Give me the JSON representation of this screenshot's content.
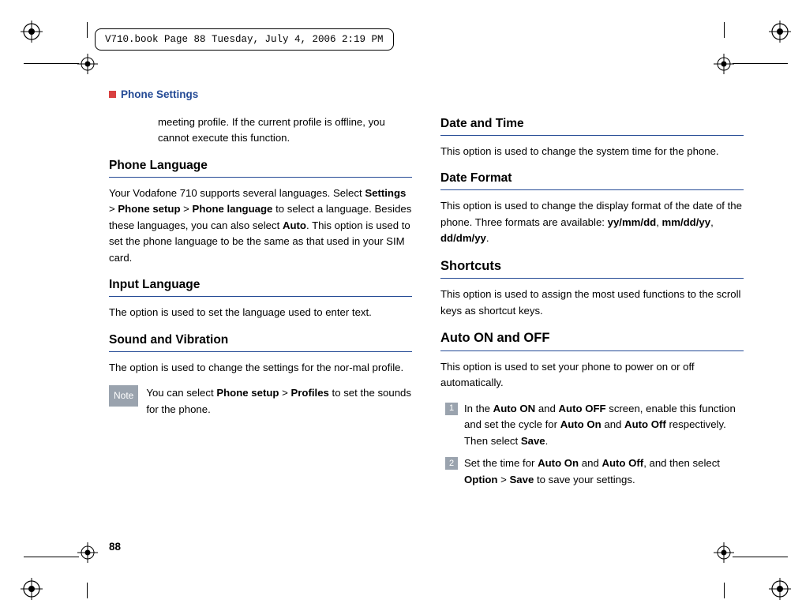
{
  "header": {
    "file_info": "V710.book  Page 88  Tuesday, July 4, 2006  2:19 PM"
  },
  "section": {
    "title": "Phone Settings"
  },
  "left": {
    "continued": "meeting profile. If the current profile is offline, you cannot execute this function.",
    "h_phone_lang": "Phone Language",
    "p_phone_lang_1": "Your Vodafone 710 supports several languages. Select ",
    "p_phone_lang_b1": "Settings",
    "p_phone_lang_2": " > ",
    "p_phone_lang_b2": "Phone setup",
    "p_phone_lang_3": " > ",
    "p_phone_lang_b3": "Phone language",
    "p_phone_lang_4": " to select a language. Besides these languages, you can also select ",
    "p_phone_lang_b4": "Auto",
    "p_phone_lang_5": ". This option is used to set the phone language to be the same as that used in your SIM card.",
    "h_input_lang": "Input Language",
    "p_input_lang": "The option is used to set the language used to enter text.",
    "h_sound": "Sound and Vibration",
    "p_sound": "The option is used to change the settings for the nor-mal profile.",
    "note_label": "Note",
    "note_1": "You can select ",
    "note_b1": "Phone setup",
    "note_2": " > ",
    "note_b2": "Profiles",
    "note_3": " to set the sounds for the phone."
  },
  "right": {
    "h_date_time": "Date and Time",
    "p_date_time": "This option is used to change the system time for  the phone.",
    "h_date_format": "Date Format",
    "p_date_format_1": "This option is used to change the display format of the date of the phone. Three formats are available: ",
    "p_date_format_b1": "yy/mm/dd",
    "p_date_format_2": ", ",
    "p_date_format_b2": "mm/dd/yy",
    "p_date_format_3": ", ",
    "p_date_format_b3": "dd/dm/yy",
    "p_date_format_4": ".",
    "h_shortcuts": "Shortcuts",
    "p_shortcuts": "This option is used to assign the most used functions to the scroll keys as shortcut keys.",
    "h_auto": "Auto ON and OFF",
    "p_auto": "This option is used to set your phone to power on or off automatically.",
    "step1_num": "1",
    "step1_1": "In the ",
    "step1_b1": "Auto ON",
    "step1_2": " and ",
    "step1_b2": "Auto OFF",
    "step1_3": " screen, enable this function and set the cycle for ",
    "step1_b3": "Auto On",
    "step1_4": " and ",
    "step1_b4": "Auto Off",
    "step1_5": " respectively. Then select ",
    "step1_b5": "Save",
    "step1_6": ".",
    "step2_num": "2",
    "step2_1": "Set the time for ",
    "step2_b1": "Auto On",
    "step2_2": " and ",
    "step2_b2": "Auto Off",
    "step2_3": ", and then select ",
    "step2_b3": "Option",
    "step2_4": " > ",
    "step2_b4": "Save",
    "step2_5": " to save your settings."
  },
  "page_number": "88"
}
